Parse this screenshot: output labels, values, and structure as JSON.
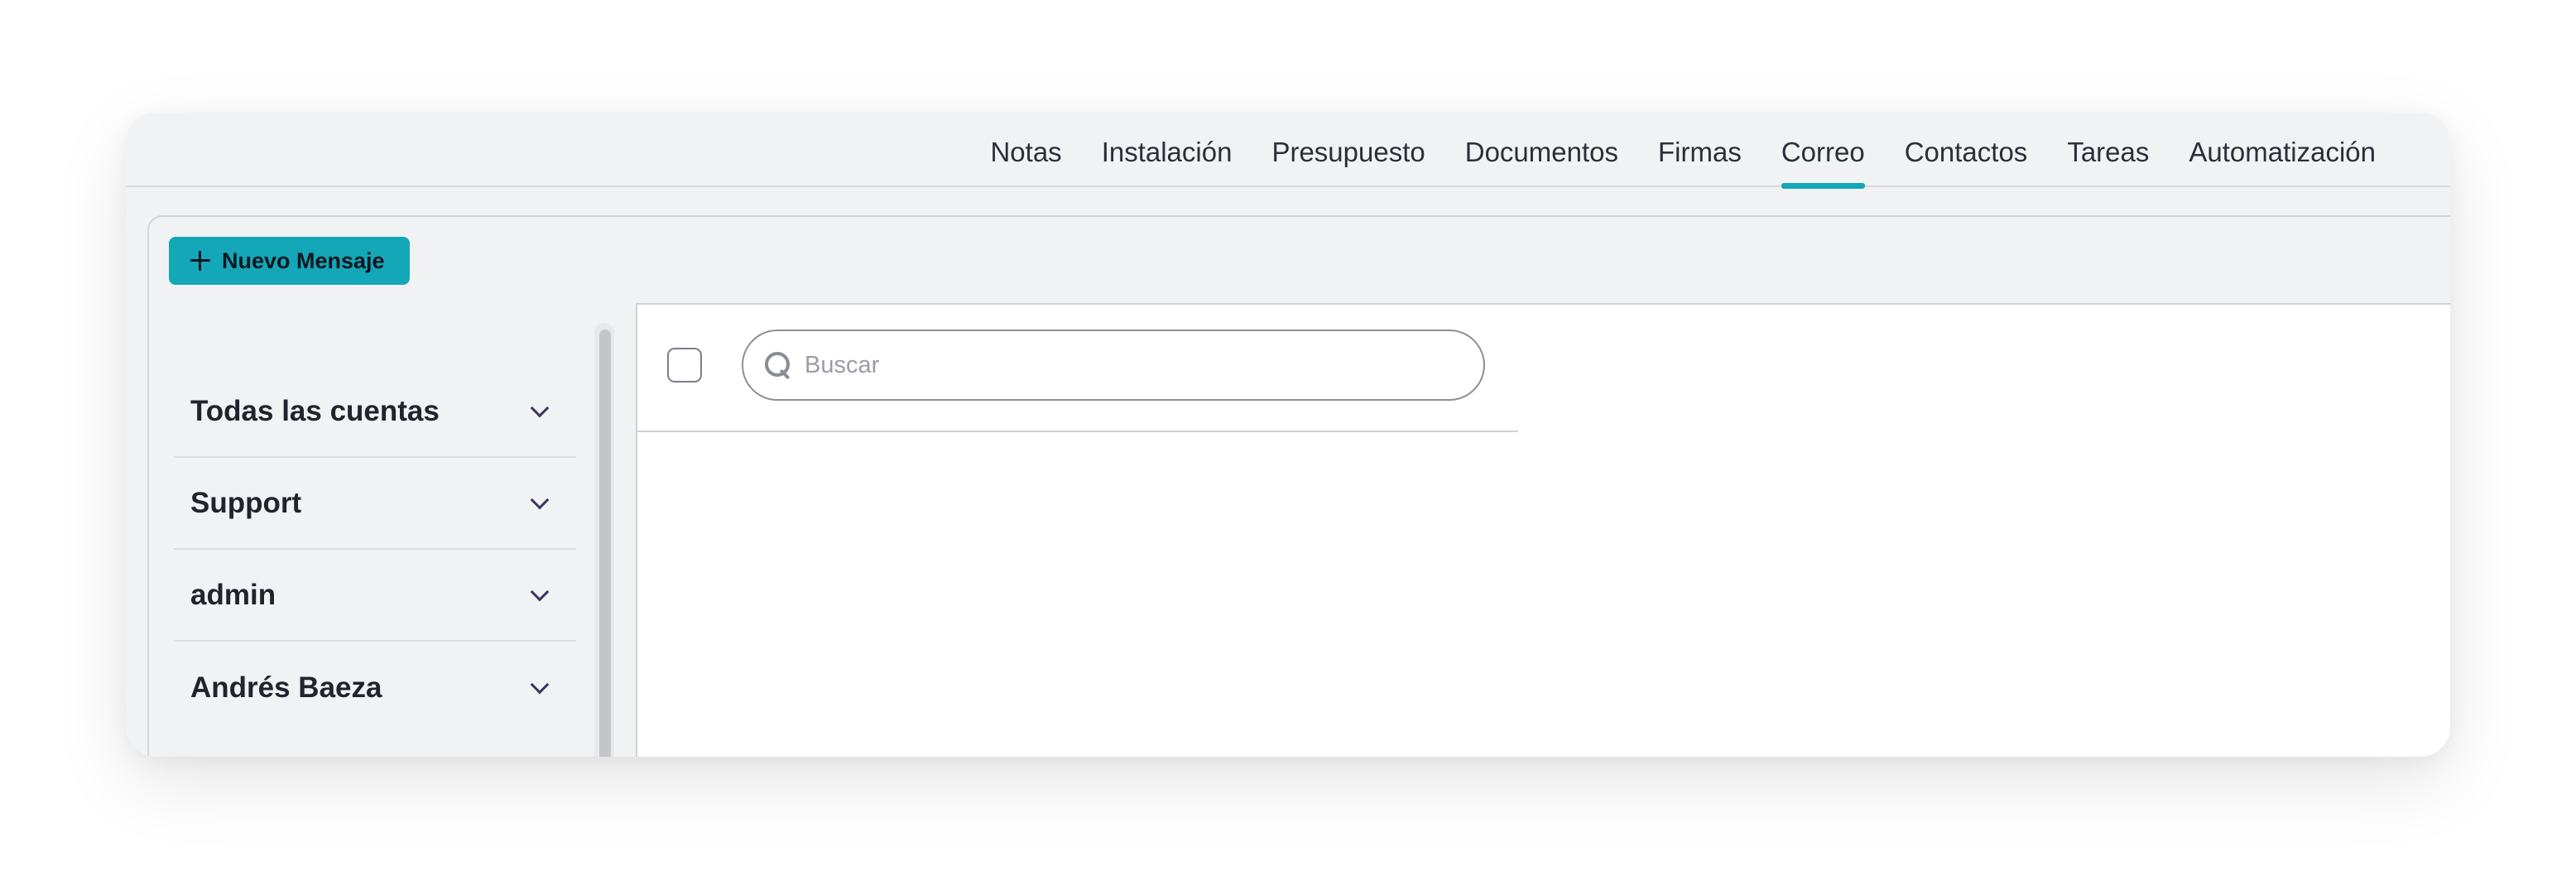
{
  "tabs": [
    {
      "label": "Notas",
      "active": false
    },
    {
      "label": "Instalación",
      "active": false
    },
    {
      "label": "Presupuesto",
      "active": false
    },
    {
      "label": "Documentos",
      "active": false
    },
    {
      "label": "Firmas",
      "active": false
    },
    {
      "label": "Correo",
      "active": true
    },
    {
      "label": "Contactos",
      "active": false
    },
    {
      "label": "Tareas",
      "active": false
    },
    {
      "label": "Automatización",
      "active": false
    }
  ],
  "toolbar": {
    "new_message_label": "Nuevo Mensaje",
    "new_message_icon": "plus-icon"
  },
  "accounts": [
    {
      "label": "Todas las cuentas",
      "icon": "chevron-down-icon"
    },
    {
      "label": "Support",
      "icon": "chevron-down-icon"
    },
    {
      "label": "admin",
      "icon": "chevron-down-icon"
    },
    {
      "label": "Andrés Baeza",
      "icon": "chevron-down-icon"
    }
  ],
  "message_list": {
    "search": {
      "placeholder": "Buscar",
      "value": "",
      "icon": "search-icon"
    },
    "select_all_checked": false
  },
  "colors": {
    "accent": "#13a7b8",
    "background": "#f1f2f4",
    "panel": "#ffffff"
  }
}
